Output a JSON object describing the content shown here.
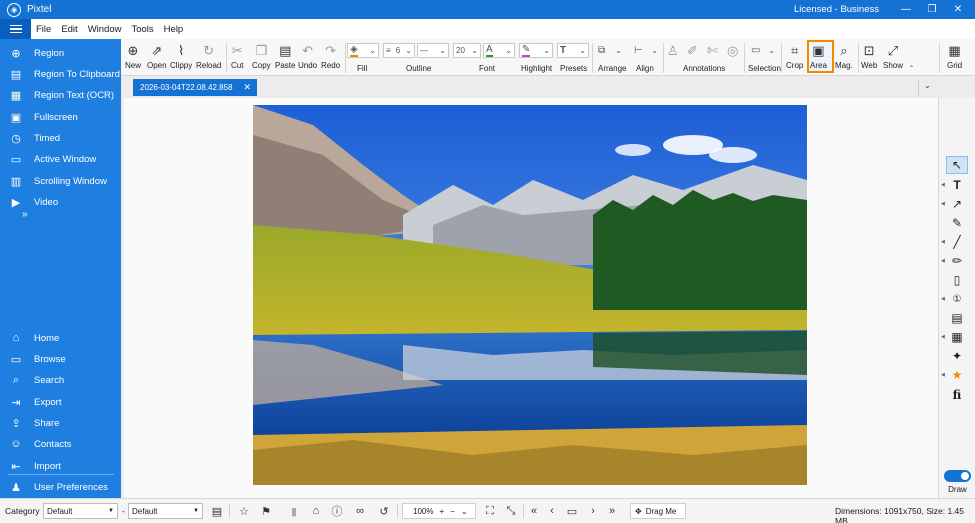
{
  "titlebar": {
    "app_name": "Pixtel",
    "license": "Licensed - Business",
    "min": "—",
    "max": "❐",
    "close": "✕"
  },
  "menu": [
    "File",
    "Edit",
    "Window",
    "Tools",
    "Help"
  ],
  "sidebar": {
    "capture_items": [
      {
        "label": "Region",
        "icon": "target-icon",
        "glyph": "⊕"
      },
      {
        "label": "Region To Clipboard",
        "icon": "clipboard-icon",
        "glyph": "▤"
      },
      {
        "label": "Region Text (OCR)",
        "icon": "document-text-icon",
        "glyph": "▦"
      },
      {
        "label": "Fullscreen",
        "icon": "fullscreen-icon",
        "glyph": "▣"
      },
      {
        "label": "Timed",
        "icon": "timer-icon",
        "glyph": "◷"
      },
      {
        "label": "Active Window",
        "icon": "window-icon",
        "glyph": "▭"
      },
      {
        "label": "Scrolling Window",
        "icon": "scroll-window-icon",
        "glyph": "▥"
      },
      {
        "label": "Video",
        "icon": "video-camera-icon",
        "glyph": "▶"
      }
    ],
    "more": "»",
    "nav_items": [
      {
        "label": "Home",
        "icon": "home-icon",
        "glyph": "⌂"
      },
      {
        "label": "Browse",
        "icon": "folder-icon",
        "glyph": "▭"
      },
      {
        "label": "Search",
        "icon": "search-icon",
        "glyph": "⌕"
      },
      {
        "label": "Export",
        "icon": "export-icon",
        "glyph": "⇥"
      },
      {
        "label": "Share",
        "icon": "share-icon",
        "glyph": "⇪"
      },
      {
        "label": "Contacts",
        "icon": "contacts-icon",
        "glyph": "☺"
      },
      {
        "label": "Import",
        "icon": "import-icon",
        "glyph": "⇤"
      },
      {
        "label": "User Preferences",
        "icon": "user-icon",
        "glyph": "♟"
      }
    ]
  },
  "ribbon": {
    "new": "New",
    "open": "Open",
    "clippy": "Clippy",
    "reload": "Reload",
    "cut": "Cut",
    "copy": "Copy",
    "paste": "Paste",
    "undo": "Undo",
    "redo": "Redo",
    "fill": "Fill",
    "outline": "Outline",
    "outline_width": "6",
    "font": "Font",
    "font_size": "20",
    "highlight": "Highlight",
    "presets": "Presets",
    "arrange": "Arrange",
    "align": "Align",
    "annotations": "Annotations",
    "selection": "Selection",
    "crop": "Crop",
    "area": "Area",
    "mag": "Mag.",
    "web": "Web",
    "show": "Show",
    "grid": "Grid"
  },
  "tab": {
    "label": "2026-03-04T22.08.42.858",
    "close": "✕"
  },
  "rail": {
    "draw": "Draw"
  },
  "statusbar": {
    "category_label": "Category",
    "category_value": "Default",
    "dash": "-",
    "second_value": "Default",
    "zoom": "100%",
    "drag_me": "Drag Me",
    "dimensions": "Dimensions: 1091x750, Size: 1.45 MB"
  }
}
